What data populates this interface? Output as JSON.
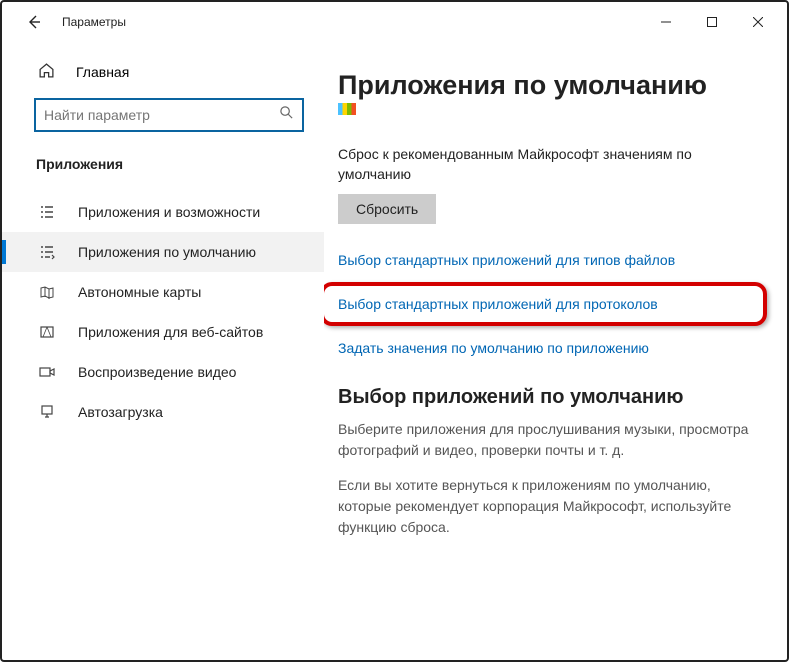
{
  "titlebar": {
    "title": "Параметры"
  },
  "sidebar": {
    "home": "Главная",
    "search_placeholder": "Найти параметр",
    "section": "Приложения",
    "items": [
      {
        "label": "Приложения и возможности"
      },
      {
        "label": "Приложения по умолчанию"
      },
      {
        "label": "Автономные карты"
      },
      {
        "label": "Приложения для веб-сайтов"
      },
      {
        "label": "Воспроизведение видео"
      },
      {
        "label": "Автозагрузка"
      }
    ]
  },
  "main": {
    "title": "Приложения по умолчанию",
    "reset_text": "Сброс к рекомендованным Майкрософт значениям по умолчанию",
    "reset_button": "Сбросить",
    "link_filetypes": "Выбор стандартных приложений для типов файлов",
    "link_protocols": "Выбор стандартных приложений для протоколов",
    "link_byapp": "Задать значения по умолчанию по приложению",
    "sub_title": "Выбор приложений по умолчанию",
    "body1": "Выберите приложения для прослушивания музыки, просмотра фотографий и видео, проверки почты и т. д.",
    "body2": "Если вы хотите вернуться к приложениям по умолчанию, которые рекомендует корпорация Майкрософт, используйте функцию сброса."
  }
}
